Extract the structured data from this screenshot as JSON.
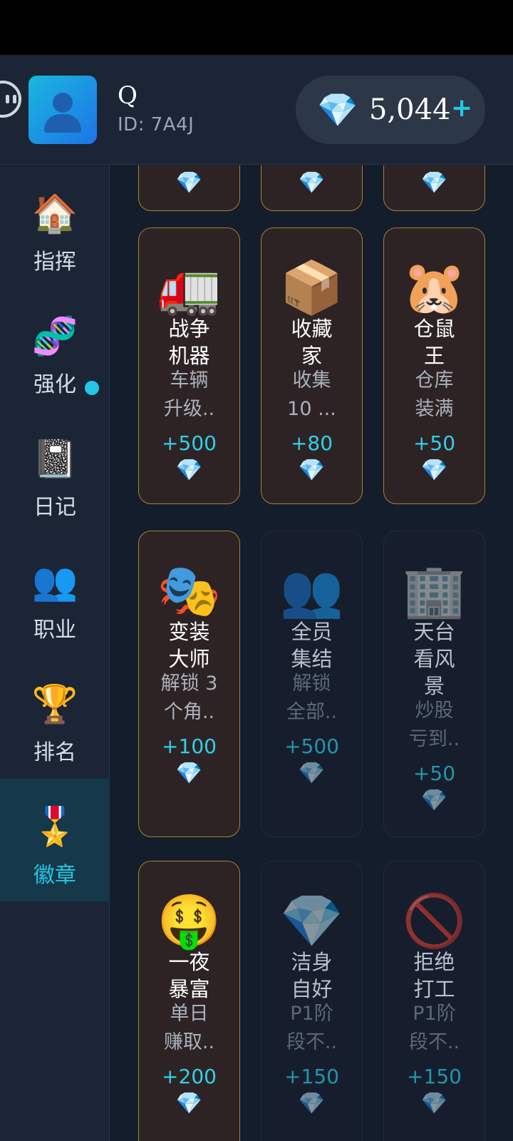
{
  "header": {
    "user_name": "Q",
    "user_id": "ID: 7A4J",
    "gem_amount": "5,044",
    "add_label": "+",
    "gem_icon": "💎",
    "avatar_icon": "person-silhouette-icon"
  },
  "sidebar": {
    "items": [
      {
        "icon": "🏠",
        "label": "指挥"
      },
      {
        "icon": "🧬",
        "label": "强化"
      },
      {
        "icon": "📓",
        "label": "日记"
      },
      {
        "icon": "👥",
        "label": "职业"
      },
      {
        "icon": "🏆",
        "label": "排名"
      },
      {
        "icon": "🎖️",
        "label": "徽章"
      }
    ],
    "active_index": 5,
    "notification_item": "日记"
  },
  "achievements": {
    "cards": [
      {
        "icon": "",
        "title": "",
        "desc": "",
        "reward": "",
        "gem": "💎",
        "status": "unlocked"
      },
      {
        "icon": "",
        "title": "",
        "desc": "",
        "reward": "",
        "gem": "💎",
        "status": "unlocked"
      },
      {
        "icon": "",
        "title": "",
        "desc": "",
        "reward": "",
        "gem": "💎",
        "status": "unlocked"
      },
      {
        "icon": "🚛",
        "title": "战争\n机器",
        "desc": "车辆\n升级..",
        "reward": "+500",
        "gem": "💎",
        "status": "unlocked"
      },
      {
        "icon": "📦",
        "title": "收藏\n家",
        "desc": "收集\n10 ...",
        "reward": "+80",
        "gem": "💎",
        "status": "unlocked"
      },
      {
        "icon": "🐹",
        "title": "仓鼠\n王",
        "desc": "仓库\n装满",
        "reward": "+50",
        "gem": "💎",
        "status": "unlocked"
      },
      {
        "icon": "🎭",
        "title": "变装\n大师",
        "desc": "解锁 3\n个角..",
        "reward": "+100",
        "gem": "💎",
        "status": "unlocked"
      },
      {
        "icon": "👥",
        "title": "全员\n集结",
        "desc": "解锁\n全部..",
        "reward": "+500",
        "gem": "💎",
        "status": "locked"
      },
      {
        "icon": "🏢",
        "title": "天台\n看风\n景",
        "desc": "炒股\n亏到..",
        "reward": "+50",
        "gem": "💎",
        "status": "locked"
      },
      {
        "icon": "🤑",
        "title": "一夜\n暴富",
        "desc": "单日\n赚取..",
        "reward": "+200",
        "gem": "💎",
        "status": "unlocked"
      },
      {
        "icon": "💎",
        "title": "洁身\n自好",
        "desc": "P1阶\n段不..",
        "reward": "+150",
        "gem": "💎",
        "status": "locked"
      },
      {
        "icon": "🚫",
        "title": "拒绝\n打工",
        "desc": "P1阶\n段不..",
        "reward": "+150",
        "gem": "💎",
        "status": "locked"
      }
    ]
  },
  "colors": {
    "accent": "#22c8e6",
    "card_unlocked_border": "#a5812f",
    "card_unlocked_bg": "#2e2324",
    "card_locked_bg": "#161e2d",
    "background": "#141d2c"
  }
}
